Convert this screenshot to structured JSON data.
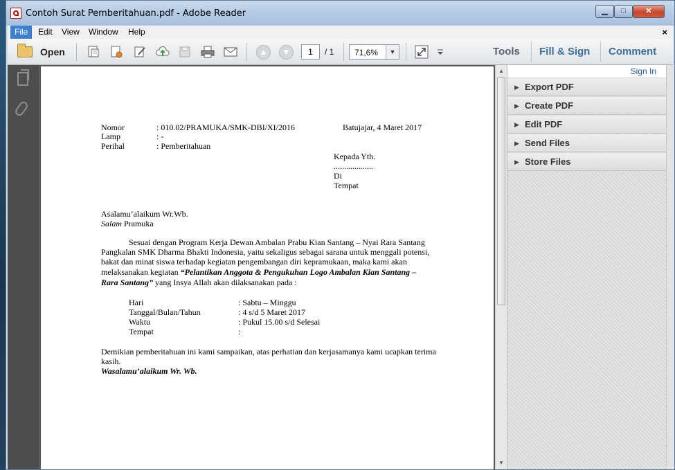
{
  "window": {
    "title": "Contoh Surat Pemberitahuan.pdf - Adobe Reader",
    "controls": {
      "minimize": "▁",
      "maximize": "□",
      "close": "✕"
    }
  },
  "menu": {
    "items": [
      "File",
      "Edit",
      "View",
      "Window",
      "Help"
    ],
    "close_doc": "×"
  },
  "toolbar": {
    "open_label": "Open",
    "page_current": "1",
    "page_total": "/ 1",
    "zoom": "71,6%",
    "tabs": {
      "tools": "Tools",
      "fill_sign": "Fill & Sign",
      "comment": "Comment"
    }
  },
  "icons": {
    "open": "folder-icon",
    "create": "create-pdf-icon",
    "edit": "edit-pdf-icon",
    "sign": "sign-icon",
    "upload": "cloud-upload-icon",
    "save": "save-icon",
    "print": "print-icon",
    "email": "email-icon",
    "prev": "prev-page-icon",
    "next": "next-page-icon",
    "fullscreen": "fullscreen-icon"
  },
  "right_pane": {
    "sign_in": "Sign In",
    "panels": [
      "Export PDF",
      "Create PDF",
      "Edit PDF",
      "Send Files",
      "Store Files"
    ]
  },
  "letter": {
    "header": {
      "nomor_label": "Nomor",
      "nomor_value": ": 010.02/PRAMUKA/SMK-DBI/XI/2016",
      "lamp_label": "Lamp",
      "lamp_value": ": -",
      "perihal_label": "Perihal",
      "perihal_value": ": Pemberitahuan",
      "place_date": "Batujajar, 4 Maret 2017"
    },
    "recipient": {
      "line1": "Kepada Yth.",
      "line2": "...................",
      "line3": "Di",
      "line4": "Tempat"
    },
    "greeting1": "Asalamu’alaikum Wr.Wb.",
    "greeting2_italic": "Salam",
    "greeting2_rest": " Pramuka",
    "body": {
      "l1": "Sesuai dengan Program Kerja Dewan Ambalan Prabu Kian Santang – Nyai Rara Santang",
      "l2": "Pangkalan SMK Dharma Bhakti Indonesia, yaitu sekaligus sebagai sarana untuk menggali potensi,",
      "l3": "bakat dan minat siswa terhadap kegiatan pengembangan diri kepramukaan, maka kami akan",
      "l4_plain": "melaksanakan kegiatan ",
      "l4_bold": "“Pelantikan Anggota & Pengukuhan Logo Ambalan Kian Santang –",
      "l5_bold": "Rara Santang”",
      "l5_plain": " yang Insya Allah akan dilaksanakan pada  :"
    },
    "details": [
      {
        "label": "Hari",
        "value": ": Sabtu – Minggu"
      },
      {
        "label": "Tanggal/Bulan/Tahun",
        "value": ": 4 s/d 5 Maret 2017"
      },
      {
        "label": "Waktu",
        "value": ": Pukul 15.00 s/d Selesai"
      },
      {
        "label": "Tempat",
        "value": ":"
      }
    ],
    "closing": {
      "l1": "Demikian pemberitahuan ini kami sampaikan, atas perhatian dan kerjasamanya kami ucapkan terima",
      "l2": "kasih.",
      "l3": "Wasalamu’alaikum Wr. Wb."
    }
  }
}
